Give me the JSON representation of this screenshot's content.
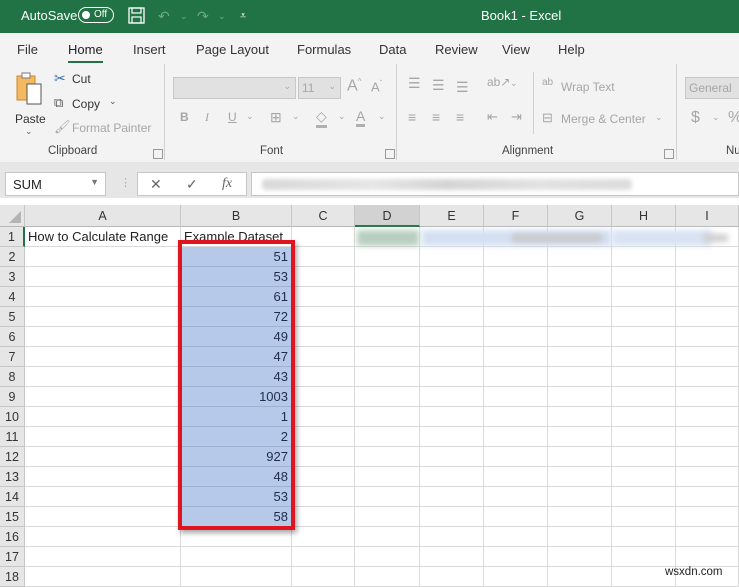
{
  "titlebar": {
    "autosave_label": "AutoSave",
    "autosave_state": "Off",
    "title": "Book1  -  Excel",
    "icons": [
      "save-icon",
      "undo-icon",
      "redo-icon",
      "customize-qat-icon"
    ]
  },
  "menu": {
    "tabs": [
      {
        "label": "File"
      },
      {
        "label": "Home",
        "active": true
      },
      {
        "label": "Insert"
      },
      {
        "label": "Page Layout"
      },
      {
        "label": "Formulas"
      },
      {
        "label": "Data"
      },
      {
        "label": "Review"
      },
      {
        "label": "View"
      },
      {
        "label": "Help"
      }
    ]
  },
  "ribbon": {
    "clipboard": {
      "label": "Clipboard",
      "paste": "Paste",
      "cut": "Cut",
      "copy": "Copy",
      "format_painter": "Format Painter"
    },
    "font": {
      "label": "Font",
      "font_name": "",
      "font_size": "11",
      "bold": "B",
      "italic": "I",
      "underline": "U"
    },
    "alignment": {
      "label": "Alignment",
      "wrap_text": "Wrap Text",
      "merge_center": "Merge & Center"
    },
    "number": {
      "label": "Nu",
      "format": "General",
      "currency": "$",
      "percent": "%"
    }
  },
  "formula_bar": {
    "name_box": "SUM",
    "cancel": "✕",
    "enter": "✓",
    "fx": "fx",
    "formula_blurred": true
  },
  "sheet": {
    "columns": [
      "A",
      "B",
      "C",
      "D",
      "E",
      "F",
      "G",
      "H",
      "I"
    ],
    "selected_column": "D",
    "rows": [
      "1",
      "2",
      "3",
      "4",
      "5",
      "6",
      "7",
      "8",
      "9",
      "10",
      "11",
      "12",
      "13",
      "14",
      "15",
      "16",
      "17",
      "18"
    ],
    "cells": {
      "A1": "How to Calculate Range",
      "B1": "Example Dataset"
    },
    "dataset": [
      51,
      53,
      61,
      72,
      49,
      47,
      43,
      1003,
      1,
      2,
      927,
      48,
      53,
      58
    ],
    "selection": "B2:B15",
    "highlight_color": "#e0141e",
    "selection_color": "#b7c9e8"
  },
  "watermark": "wsxdn.com",
  "colors": {
    "brand": "#217346"
  }
}
